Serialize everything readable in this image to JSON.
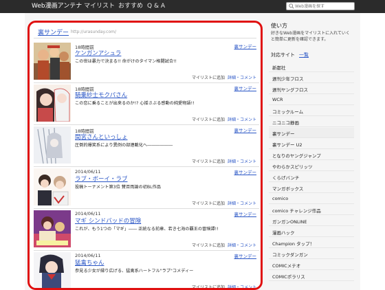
{
  "header": {
    "brand": "Web漫画アンテナ",
    "nav": [
      "マイリスト",
      "おすすめ",
      "Q & A"
    ],
    "search_placeholder": "Web漫画を探す"
  },
  "site": {
    "name": "裏サンデー",
    "url": "http://urasunday.com/"
  },
  "entries": [
    {
      "time": "18時間前",
      "title": "ケンガンアシュラ",
      "desc": "この世は暴力で決まる!! 命がけのタイマン格闘試合!!",
      "source": "裏サンデー",
      "add": "マイリストに追加",
      "detail": "詳細・コメント"
    },
    {
      "time": "18時間前",
      "title": "騎乗紗士モクパさん",
      "desc": "この恋に乗ることが出来るのか!? 心揺さぶる感動の純愛物語!!",
      "source": "裏サンデー",
      "add": "マイリストに追加",
      "detail": "詳細・コメント"
    },
    {
      "time": "18時間前",
      "title": "間宮さんといっしょ",
      "desc": "圧倒的爆笑系により異例の部連載化へ――――――",
      "source": "裏サンデー",
      "add": "マイリストに追加",
      "detail": "詳細・コメント"
    },
    {
      "time": "2014/06/11",
      "title": "ラブ・ボーイ・ラブ",
      "desc": "投稿トーナメント第3位 賛否両論の初BL作品",
      "source": "裏サンデー",
      "add": "マイリストに追加",
      "detail": "詳細・コメント"
    },
    {
      "time": "2014/06/11",
      "title": "マギ シンドバッドの冒険",
      "desc": "これが、もう1つの「マギ」―― 正統なる前章、若き七海の覇王の冒険譚!!",
      "source": "裏サンデー",
      "add": "マイリストに追加",
      "detail": "詳細・コメント"
    },
    {
      "time": "2014/06/11",
      "title": "猛禽ちゃん",
      "desc": "参見る少女が縁り広げる、猛禽系ハートフル\"ラブ\"コメディー",
      "source": "裏サンデー",
      "add": "マイリストに追加",
      "detail": "詳細・コメント"
    }
  ],
  "sidebar": {
    "how_to_title": "使い方",
    "how_to_text": "好きなWeb漫画をマイリストに入れていくと簡単に更新を確認できます。",
    "sites_title": "対応サイト",
    "sites_more": "一覧",
    "sites": [
      "新都社",
      "週刊少年フロス",
      "週刊ヤングフロス",
      "WCR",
      "コミックルーム",
      "ニコニコ静画",
      "裏サンデー",
      "裏サンデー U2",
      "となりのヤングジャンプ",
      "やわらかスピリッツ",
      "くらげバンチ",
      "マンガボックス",
      "comico",
      "comico チャレンジ作品",
      "ガンガンONLINE",
      "漫画ハック",
      "Champion タップ！",
      "コミックダンガン",
      "COMICメテオ",
      "COMICポラリス"
    ],
    "active_site": "裏サンデー"
  },
  "colors": {
    "accent_link": "#2a56c6",
    "highlight_border": "#e01010",
    "topbar": "#2b2b2b"
  }
}
